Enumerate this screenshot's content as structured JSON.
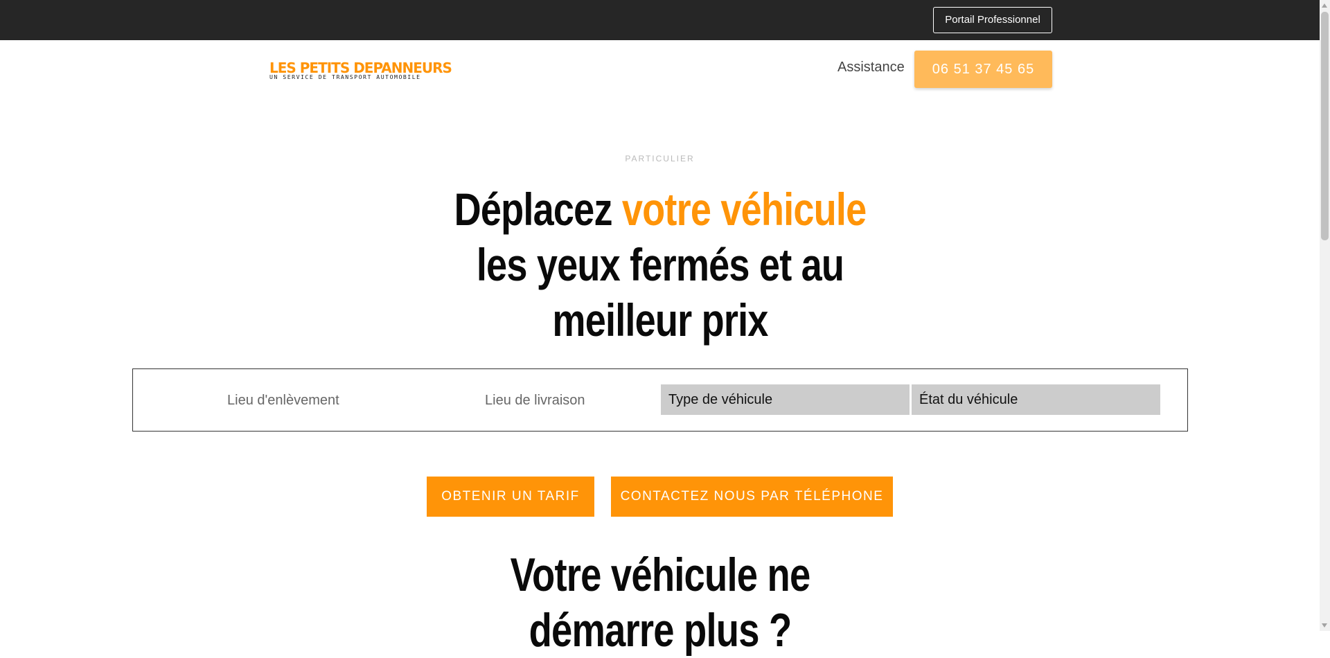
{
  "topbar": {
    "pro_portal_label": "Portail Professionnel"
  },
  "header": {
    "logo_title": "LES PETITS DEPANNEURS",
    "logo_subtitle": "UN SERVICE DE TRANSPORT AUTOMOBILE",
    "assistance_label": "Assistance",
    "phone_label": "06 51 37 45 65"
  },
  "hero": {
    "eyebrow": "PARTICULIER",
    "title_part1": "Déplacez ",
    "title_accent": "votre véhicule",
    "title_part2": "les yeux fermés et au meilleur prix"
  },
  "form": {
    "pickup_placeholder": "Lieu d'enlèvement",
    "delivery_placeholder": "Lieu de livraison",
    "vehicle_type_label": "Type de véhicule",
    "vehicle_state_label": "État du véhicule"
  },
  "actions": {
    "quote_label": "Obtenir un tarif",
    "call_label": "Contactez nous par téléphone"
  },
  "section": {
    "title": "Votre véhicule ne démarre plus ?"
  },
  "colors": {
    "accent": "#ff9408",
    "accent_light": "#ffba5a",
    "topbar": "#262626"
  },
  "icons": {
    "scroll_up": "chevron-up-icon",
    "scroll_down": "chevron-down-icon"
  }
}
